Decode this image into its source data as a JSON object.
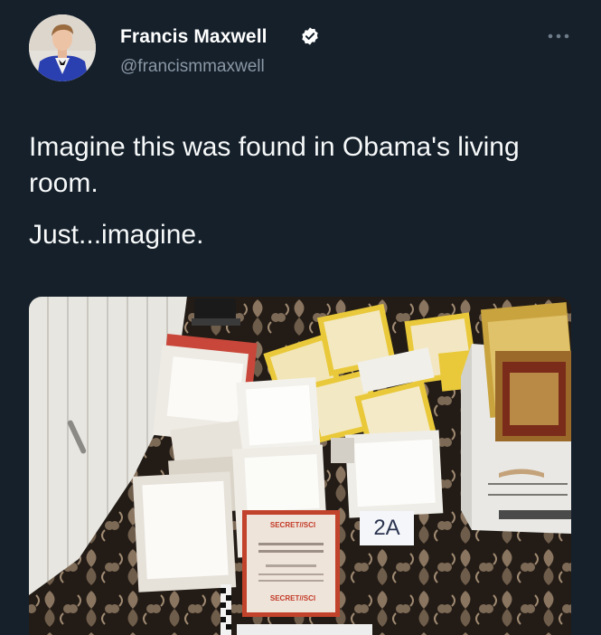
{
  "author": {
    "display_name": "Francis Maxwell",
    "handle": "@francismmaxwell",
    "verified": true
  },
  "tweet": {
    "paragraphs": [
      "Imagine this was found in Obama's living room.",
      "Just...imagine."
    ]
  },
  "media": {
    "evidence_tag": "2A",
    "document_label_top": "SECRET//SCI",
    "document_label_bottom": "SECRET//SCI"
  },
  "colors": {
    "background": "#15202b",
    "handle": "#8b98a5",
    "text": "#f7f9f9",
    "verified_badge": "#ffffff"
  },
  "icons": {
    "verified": "verified-badge-icon",
    "more": "more-options-icon"
  }
}
